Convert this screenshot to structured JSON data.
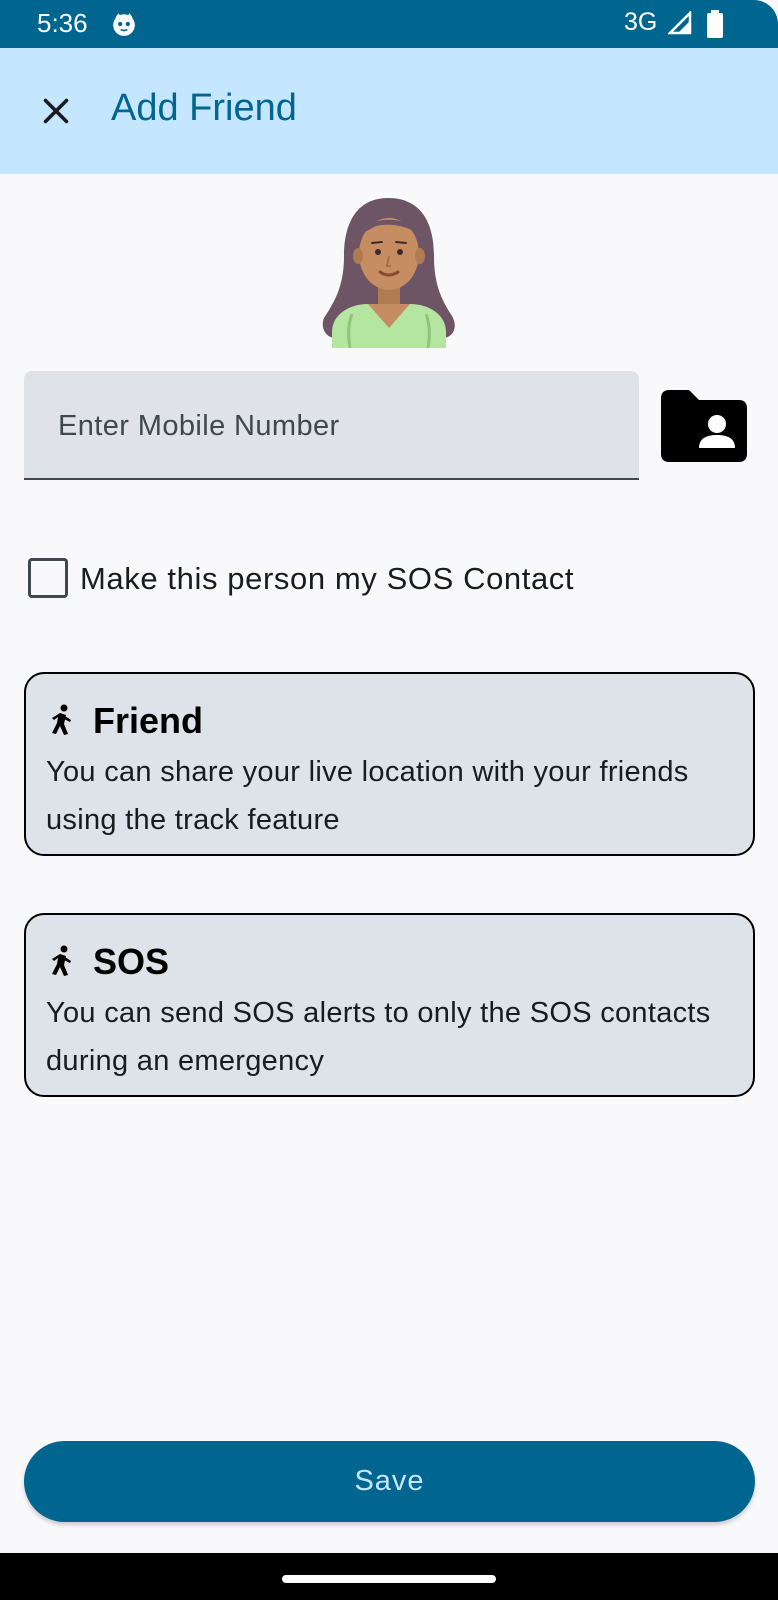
{
  "status_bar": {
    "time": "5:36",
    "network": "3G",
    "icons": [
      "cat-notification-icon",
      "signal-icon",
      "battery-icon"
    ]
  },
  "app_bar": {
    "title": "Add Friend",
    "close_icon": "close-icon"
  },
  "avatar": {
    "icon": "avatar-woman-illustration"
  },
  "mobile_input": {
    "placeholder": "Enter Mobile Number",
    "value": ""
  },
  "contact_picker": {
    "icon": "contacts-folder-icon"
  },
  "sos_checkbox": {
    "label": "Make this person my SOS Contact",
    "checked": false
  },
  "cards": [
    {
      "title": "Friend",
      "description": "You can share your live location with your friends using the track feature",
      "icon": "running-person-icon"
    },
    {
      "title": "SOS",
      "description": "You can send SOS alerts to only the SOS contacts during an emergency",
      "icon": "running-person-icon"
    }
  ],
  "save_button": {
    "label": "Save"
  },
  "colors": {
    "primary": "#00658f",
    "app_bar_bg": "#c4e7ff",
    "card_bg": "#dde3e8",
    "field_bg": "#dfe3e7",
    "skin": "#c68d62",
    "hair": "#6e5566",
    "shirt": "#b5e6a1"
  }
}
